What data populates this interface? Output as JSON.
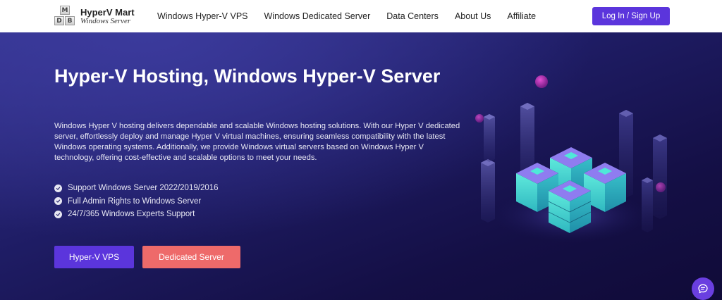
{
  "brand": {
    "logo_letters": [
      "M",
      "D",
      "B"
    ],
    "name": "HyperV Mart",
    "tagline": "Windows Server"
  },
  "nav": {
    "links": [
      "Windows Hyper-V VPS",
      "Windows Dedicated Server",
      "Data Centers",
      "About Us",
      "Affiliate"
    ],
    "login_label": "Log In / Sign Up"
  },
  "hero": {
    "title": "Hyper-V Hosting, Windows Hyper-V Server",
    "description": "Windows Hyper V hosting delivers dependable and scalable Windows hosting solutions. With our Hyper V dedicated server, effortlessly deploy and manage Hyper V virtual machines, ensuring seamless compatibility with the latest Windows operating systems. Additionally, we provide Windows virtual servers based on Windows Hyper V technology, offering cost-effective and scalable options to meet your needs.",
    "features": [
      "Support Windows Server 2022/2019/2016",
      "Full Admin Rights to Windows Server",
      "24/7/365 Windows Experts Support"
    ],
    "primary_button": "Hyper-V VPS",
    "secondary_button": "Dedicated Server"
  },
  "icons": {
    "feature": "check-circle-icon",
    "chat": "chat-bubble-icon",
    "illustration": "server-stack-illustration"
  },
  "colors": {
    "primary": "#5b35dc",
    "secondary": "#ee6a6a",
    "hero_bg": "#1f1d66",
    "glow": "#4fe8d8"
  }
}
